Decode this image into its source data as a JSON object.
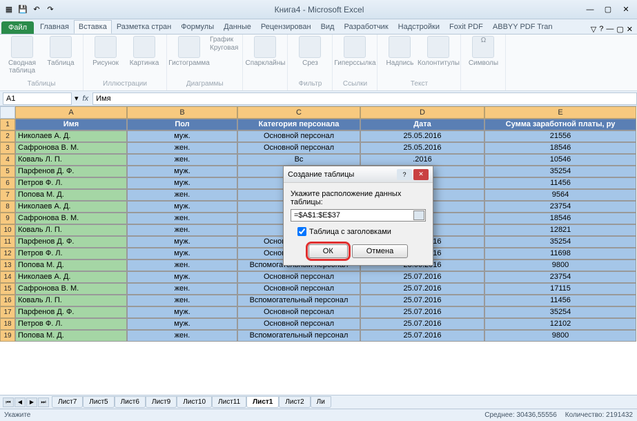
{
  "title": "Книга4  -  Microsoft Excel",
  "ribbon_tabs": {
    "file": "Файл",
    "home": "Главная",
    "insert": "Вставка",
    "layout": "Разметка стран",
    "formulas": "Формулы",
    "data": "Данные",
    "review": "Рецензирован",
    "view": "Вид",
    "developer": "Разработчик",
    "addins": "Надстройки",
    "foxit": "Foxit PDF",
    "abbyy": "ABBYY PDF Tran"
  },
  "ribbon_groups": {
    "tables": {
      "pivot": "Сводная таблица",
      "table": "Таблица",
      "label": "Таблицы"
    },
    "illustrations": {
      "picture": "Рисунок",
      "clipart": "Картинка",
      "label": "Иллюстрации"
    },
    "charts": {
      "column": "Гистограмма",
      "line": "График",
      "pie": "Круговая",
      "label": "Диаграммы"
    },
    "sparklines": {
      "btn": "Спарклайны"
    },
    "filter": {
      "slicer": "Срез",
      "label": "Фильтр"
    },
    "links": {
      "hyperlink": "Гиперссылка",
      "label": "Ссылки"
    },
    "text": {
      "textbox": "Надпись",
      "header_footer": "Колонтитулы",
      "label": "Текст"
    },
    "symbols": {
      "symbol": "Символы"
    }
  },
  "name_box": "A1",
  "formula_value": "Имя",
  "columns": [
    "A",
    "B",
    "C",
    "D",
    "E"
  ],
  "headers": [
    "Имя",
    "Пол",
    "Категория персонала",
    "Дата",
    "Сумма заработной платы, ру"
  ],
  "rows": [
    {
      "n": 2,
      "name": "Николаев А. Д.",
      "sex": "муж.",
      "cat": "Основной персонал",
      "date": "25.05.2016",
      "sum": "21556"
    },
    {
      "n": 3,
      "name": "Сафронова В. М.",
      "sex": "жен.",
      "cat": "Основной персонал",
      "date": "25.05.2016",
      "sum": "18546"
    },
    {
      "n": 4,
      "name": "Коваль Л. П.",
      "sex": "жен.",
      "cat": "Вс",
      "date": ".2016",
      "sum": "10546"
    },
    {
      "n": 5,
      "name": "Парфенов Д. Ф.",
      "sex": "муж.",
      "cat": "",
      "date": ".2016",
      "sum": "35254"
    },
    {
      "n": 6,
      "name": "Петров Ф. Л.",
      "sex": "муж.",
      "cat": "",
      "date": ".2016",
      "sum": "11456"
    },
    {
      "n": 7,
      "name": "Попова М. Д.",
      "sex": "жен.",
      "cat": "Вс",
      "date": ".2016",
      "sum": "9564"
    },
    {
      "n": 8,
      "name": "Николаев А. Д.",
      "sex": "муж.",
      "cat": "",
      "date": ".2016",
      "sum": "23754"
    },
    {
      "n": 9,
      "name": "Сафронова В. М.",
      "sex": "жен.",
      "cat": "",
      "date": ".2016",
      "sum": "18546"
    },
    {
      "n": 10,
      "name": "Коваль Л. П.",
      "sex": "жен.",
      "cat": "Вс",
      "date": ".2016",
      "sum": "12821"
    },
    {
      "n": 11,
      "name": "Парфенов Д. Ф.",
      "sex": "муж.",
      "cat": "Основной персонал",
      "date": "23.06.2016",
      "sum": "35254"
    },
    {
      "n": 12,
      "name": "Петров Ф. Л.",
      "sex": "муж.",
      "cat": "Основной персонал",
      "date": "23.06.2016",
      "sum": "11698"
    },
    {
      "n": 13,
      "name": "Попова М. Д.",
      "sex": "жен.",
      "cat": "Вспомогательный персонал",
      "date": "23.06.2016",
      "sum": "9800"
    },
    {
      "n": 14,
      "name": "Николаев А. Д.",
      "sex": "муж.",
      "cat": "Основной персонал",
      "date": "25.07.2016",
      "sum": "23754"
    },
    {
      "n": 15,
      "name": "Сафронова В. М.",
      "sex": "жен.",
      "cat": "Основной персонал",
      "date": "25.07.2016",
      "sum": "17115"
    },
    {
      "n": 16,
      "name": "Коваль Л. П.",
      "sex": "жен.",
      "cat": "Вспомогательный персонал",
      "date": "25.07.2016",
      "sum": "11456"
    },
    {
      "n": 17,
      "name": "Парфенов Д. Ф.",
      "sex": "муж.",
      "cat": "Основной персонал",
      "date": "25.07.2016",
      "sum": "35254"
    },
    {
      "n": 18,
      "name": "Петров Ф. Л.",
      "sex": "муж.",
      "cat": "Основной персонал",
      "date": "25.07.2016",
      "sum": "12102"
    },
    {
      "n": 19,
      "name": "Попова М. Д.",
      "sex": "жен.",
      "cat": "Вспомогательный персонал",
      "date": "25.07.2016",
      "sum": "9800"
    }
  ],
  "sheets": [
    "Лист7",
    "Лист5",
    "Лист6",
    "Лист9",
    "Лист10",
    "Лист11",
    "Лист1",
    "Лист2",
    "Ли"
  ],
  "active_sheet": "Лист1",
  "status": {
    "mode": "Укажите",
    "avg": "Среднее: 30436,55556",
    "count": "Количество: 2191432"
  },
  "dialog": {
    "title": "Создание таблицы",
    "prompt": "Укажите расположение данных таблицы:",
    "range": "=$A$1:$E$37",
    "checkbox": "Таблица с заголовками",
    "ok": "ОК",
    "cancel": "Отмена"
  }
}
